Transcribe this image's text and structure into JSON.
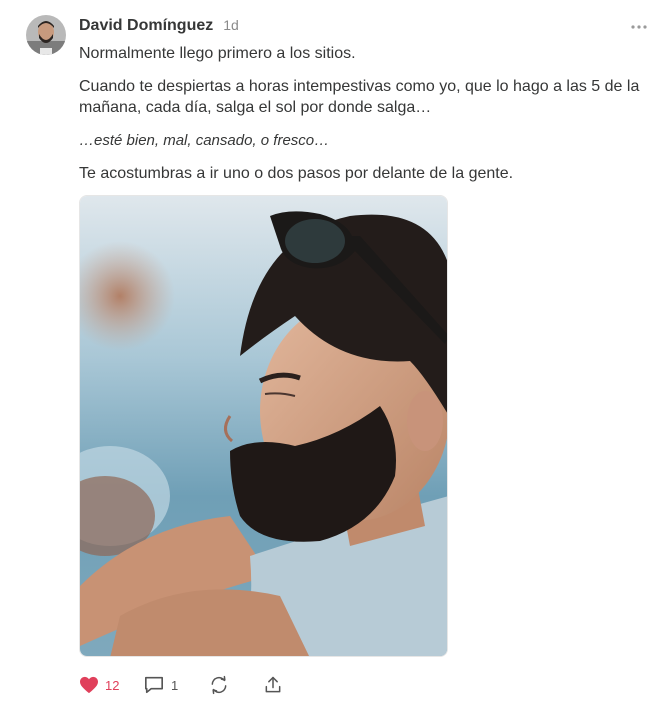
{
  "post": {
    "author": "David Domínguez",
    "timestamp": "1d",
    "paragraphs": [
      "Normalmente llego primero a los sitios.",
      "Cuando te despiertas a horas intempestivas como yo, que lo hago a las 5 de la mañana, cada día, salga el sol por donde salga…",
      "…esté bien, mal, cansado, o fresco…",
      "Te acostumbras a ir uno o dos pasos por delante de la gente."
    ]
  },
  "actions": {
    "like_icon": "heart-icon",
    "like_count": "12",
    "comment_icon": "comment-icon",
    "comment_count": "1",
    "restack_icon": "restack-icon",
    "share_icon": "share-icon"
  },
  "icons": {
    "more": "more-dots-icon"
  },
  "colors": {
    "text": "#363737",
    "muted": "#8a8a8a",
    "like": "#e0405b"
  }
}
